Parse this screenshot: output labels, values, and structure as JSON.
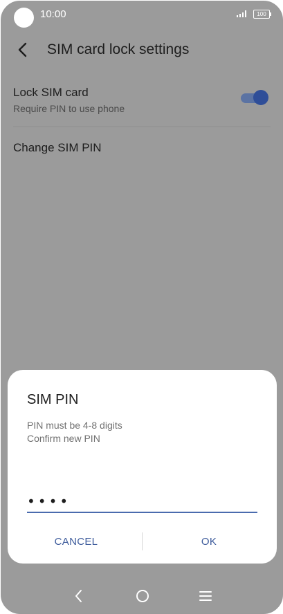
{
  "status_bar": {
    "time": "10:00",
    "battery": "100",
    "icons": [
      "signal-icon",
      "battery-icon"
    ]
  },
  "app_bar": {
    "title": "SIM card lock settings",
    "back_icon": "chevron-left-icon"
  },
  "settings": {
    "lock_sim": {
      "title": "Lock SIM card",
      "subtitle": "Require PIN to use phone",
      "enabled": true
    },
    "change_pin": {
      "title": "Change SIM PIN"
    }
  },
  "dialog": {
    "title": "SIM PIN",
    "message_1": "PIN must be 4-8 digits",
    "message_2": "Confirm new PIN",
    "pin_value": "••••",
    "cancel_label": "CANCEL",
    "ok_label": "OK"
  },
  "nav_bar": {
    "icons": [
      "back-icon",
      "home-icon",
      "recents-icon"
    ]
  },
  "colors": {
    "accent": "#3e5c9c",
    "switch_thumb": "#2f4e98",
    "scrim": "#9b9b9b"
  }
}
